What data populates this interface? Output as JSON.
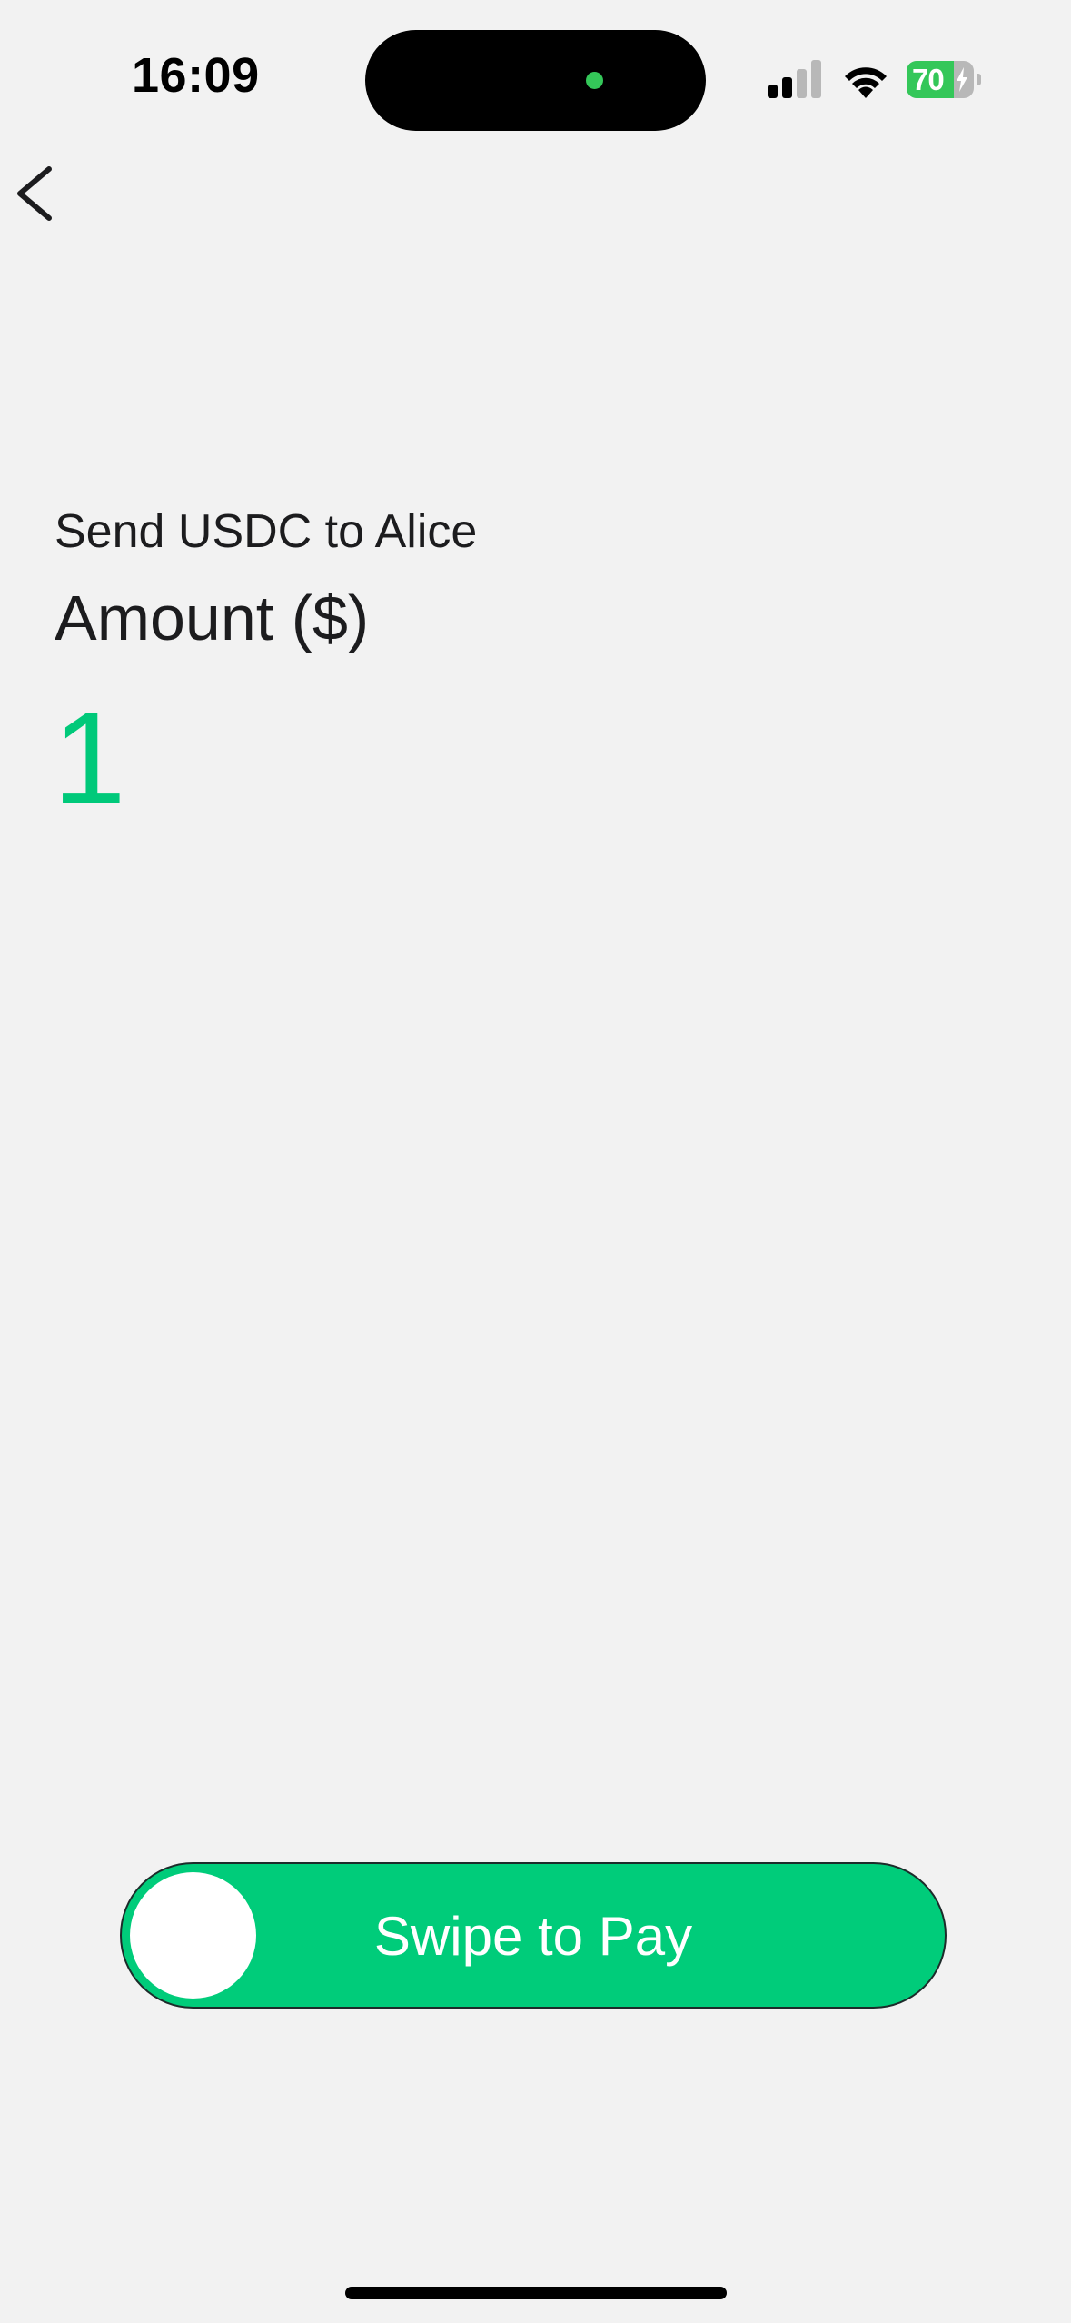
{
  "status_bar": {
    "time": "16:09",
    "battery_percent": "70",
    "battery_level": 0.7,
    "charging": true,
    "signal_bars_active": 2,
    "signal_bars_total": 4
  },
  "navigation": {
    "back_icon": "chevron-left-icon"
  },
  "payment": {
    "title": "Send USDC to Alice",
    "amount_label": "Amount ($)",
    "amount_value": "1"
  },
  "swipe": {
    "label": "Swipe to Pay",
    "progress": 0
  },
  "colors": {
    "background": "#f2f2f2",
    "accent_green": "#00cc7a",
    "amount_green": "#00c97a",
    "battery_green": "#34c759",
    "text_dark": "#1c1c1e"
  }
}
